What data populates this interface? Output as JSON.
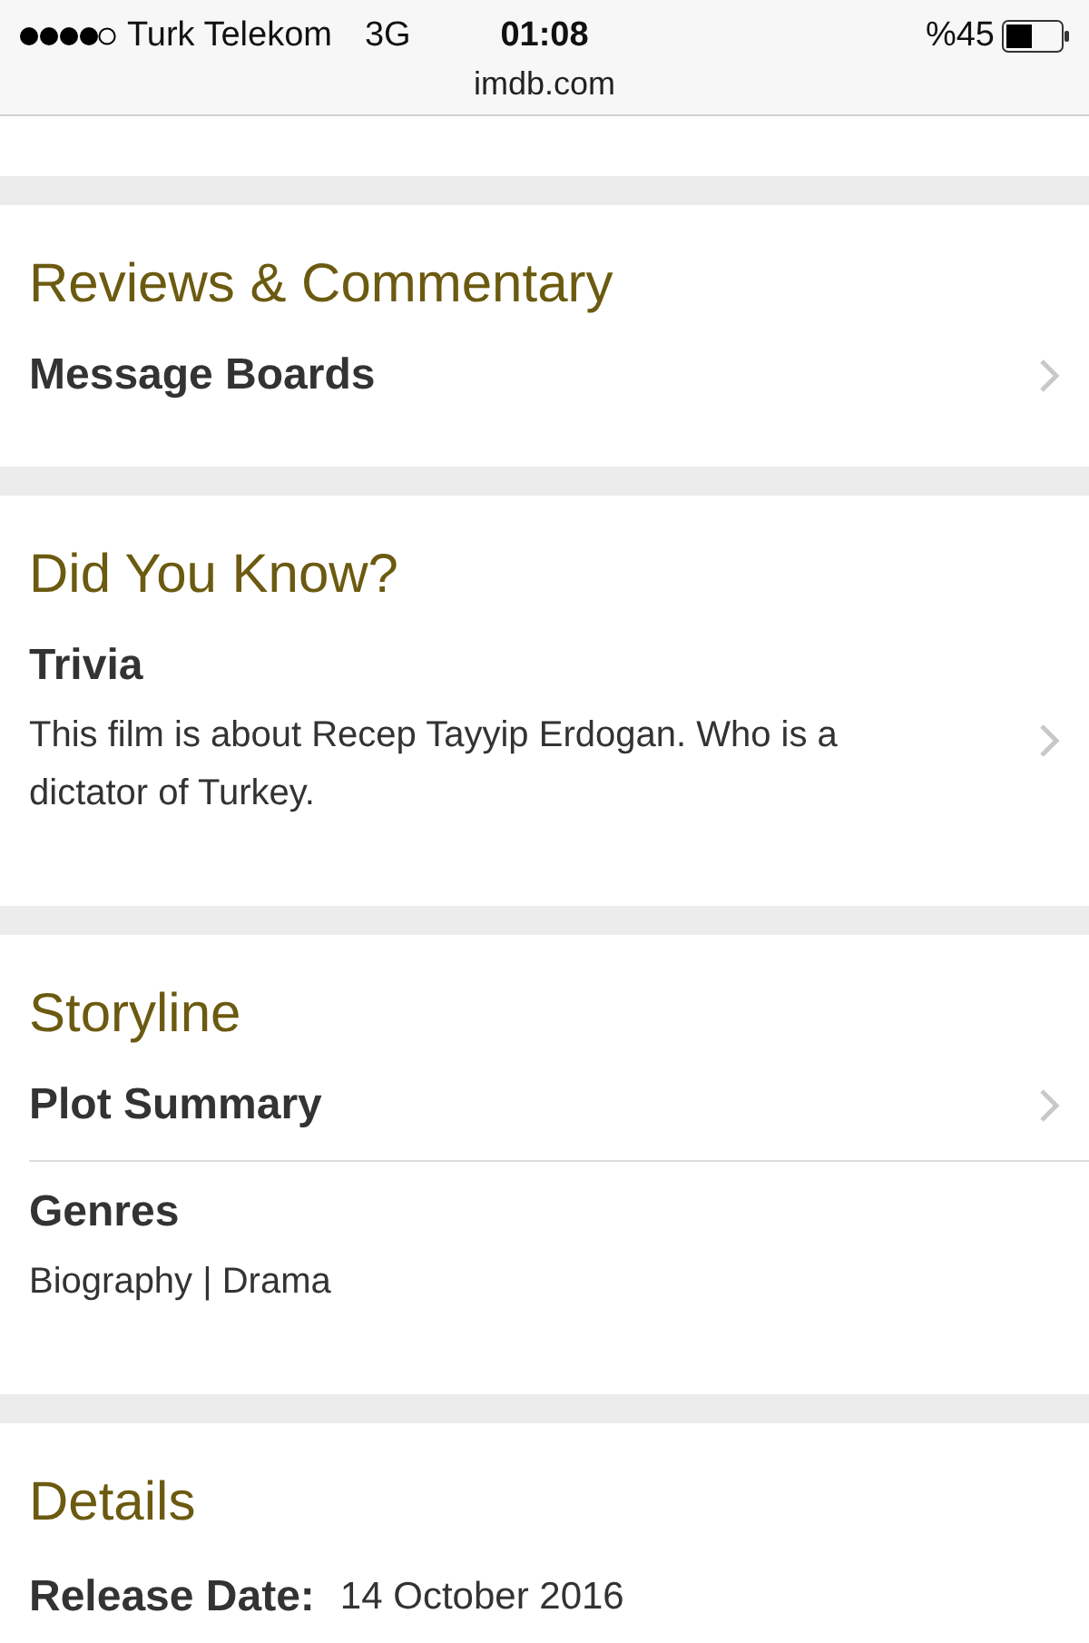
{
  "status_bar": {
    "carrier": "Turk Telekom",
    "network": "3G",
    "time": "01:08",
    "battery": "%45"
  },
  "address_bar": {
    "url": "imdb.com"
  },
  "sections": [
    {
      "title": "Reviews & Commentary",
      "items": [
        {
          "kind": "link",
          "label": "Message Boards"
        }
      ]
    },
    {
      "title": "Did You Know?",
      "items": [
        {
          "kind": "entry",
          "label": "Trivia",
          "body": "This film is about Recep Tayyip Erdogan. Who is a dictator of Turkey.",
          "chevron": true
        }
      ]
    },
    {
      "title": "Storyline",
      "items": [
        {
          "kind": "link",
          "label": "Plot Summary"
        },
        {
          "kind": "entry",
          "label": "Genres",
          "body": "Biography | Drama",
          "chevron": false
        }
      ]
    },
    {
      "title": "Details",
      "items": [
        {
          "kind": "field",
          "label": "Release Date:",
          "value": "14 October 2016"
        }
      ]
    }
  ]
}
